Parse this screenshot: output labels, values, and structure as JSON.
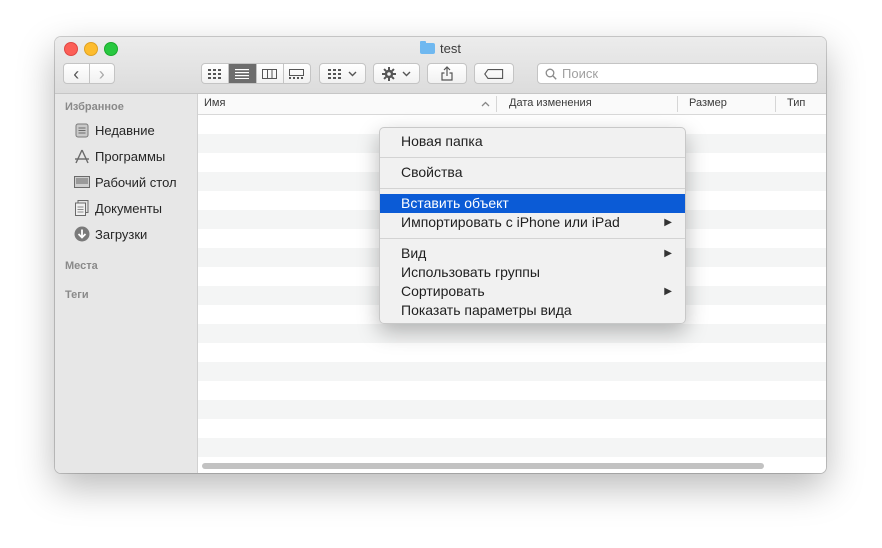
{
  "window": {
    "title": "test"
  },
  "toolbar": {
    "back": "‹",
    "forward": "›",
    "search_placeholder": "Поиск"
  },
  "sidebar": {
    "favorites_header": "Избранное",
    "items": [
      {
        "label": "Недавние",
        "icon": "recents-icon"
      },
      {
        "label": "Программы",
        "icon": "applications-icon"
      },
      {
        "label": "Рабочий стол",
        "icon": "desktop-icon"
      },
      {
        "label": "Документы",
        "icon": "documents-icon"
      },
      {
        "label": "Загрузки",
        "icon": "downloads-icon"
      }
    ],
    "locations_header": "Места",
    "tags_header": "Теги"
  },
  "columns": {
    "name": "Имя",
    "modified": "Дата изменения",
    "size": "Размер",
    "kind": "Тип"
  },
  "context_menu": {
    "items": [
      "Новая папка",
      "Свойства",
      "Вставить объект",
      "Импортировать с iPhone или iPad",
      "Вид",
      "Использовать группы",
      "Сортировать",
      "Показать параметры вида"
    ],
    "highlighted": "Вставить объект"
  },
  "colors": {
    "highlight": "#0b5bd6",
    "close": "#fc5f57",
    "minimize": "#fdbc2e",
    "maximize": "#28c840",
    "folder": "#6fb8f0"
  }
}
